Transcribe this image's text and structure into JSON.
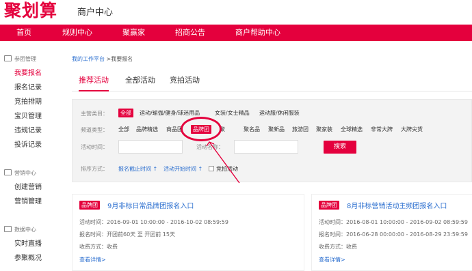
{
  "header": {
    "logo": "聚划算",
    "subtitle": "商户中心"
  },
  "topnav": {
    "items": [
      "首页",
      "规则中心",
      "聚赢家",
      "招商公告",
      "商户帮助中心"
    ]
  },
  "sidebar": {
    "group1": {
      "label": "参团管理",
      "items": [
        "我要报名",
        "报名记录",
        "竞拍排期",
        "宝贝管理",
        "违规记录",
        "投诉记录"
      ]
    },
    "group2": {
      "label": "营销中心",
      "items": [
        "创建营销",
        "营销管理"
      ]
    },
    "group3": {
      "label": "数据中心",
      "items": [
        "实时直播",
        "参聚概况"
      ]
    }
  },
  "breadcrumb": {
    "link": "我的工作平台",
    "sep": ">",
    "current": "我要报名"
  },
  "tabs": [
    "推荐活动",
    "全部活动",
    "竞拍活动"
  ],
  "filter": {
    "category_label": "主营类目：",
    "categories": [
      "全部",
      "运动/瑜伽/健身/球迷用品",
      "女装/女士精品",
      "运动服/休闲服装"
    ],
    "channel_label": "频道类型：",
    "channels": [
      "全部",
      "品牌精选",
      "商品团",
      "品牌团",
      "聚名品",
      "聚新品",
      "旅游团",
      "聚家装",
      "全球精选",
      "非常大牌",
      "大牌尖货"
    ],
    "channel_hidden": "聚",
    "time_label": "活动时间：",
    "name_label": "活动名称：",
    "search_btn": "搜索",
    "sort_label": "排序方式：",
    "sort_deadline": "报名截止时间 ↑",
    "sort_start": "活动开始时间 ↑",
    "bid_label": "竞拍活动"
  },
  "cards": [
    {
      "badge": "品牌团",
      "title": "9月非标日常品牌团报名入口",
      "time_label": "活动时间：",
      "time": "2016-09-01 10:00:00 - 2016-10-02 08:59:59",
      "signup_label": "报名时间：",
      "signup": "开团前60天 至 开团前 15天",
      "fee_label": "收费方式：",
      "fee": "收费",
      "more": "查看详情>"
    },
    {
      "badge": "品牌团",
      "title": "8月非标营销活动主频团报名入口",
      "time_label": "活动时间：",
      "time": "2016-08-01 10:00:00 - 2016-09-02 08:59:59",
      "signup_label": "报名时间：",
      "signup": "2016-06-28 00:00:00 - 2016-08-29 23:59:59",
      "fee_label": "收费方式：",
      "fee": "收费",
      "more": "查看详情>"
    }
  ],
  "colors": {
    "accent": "#e4003d",
    "link": "#2a6ecf"
  }
}
